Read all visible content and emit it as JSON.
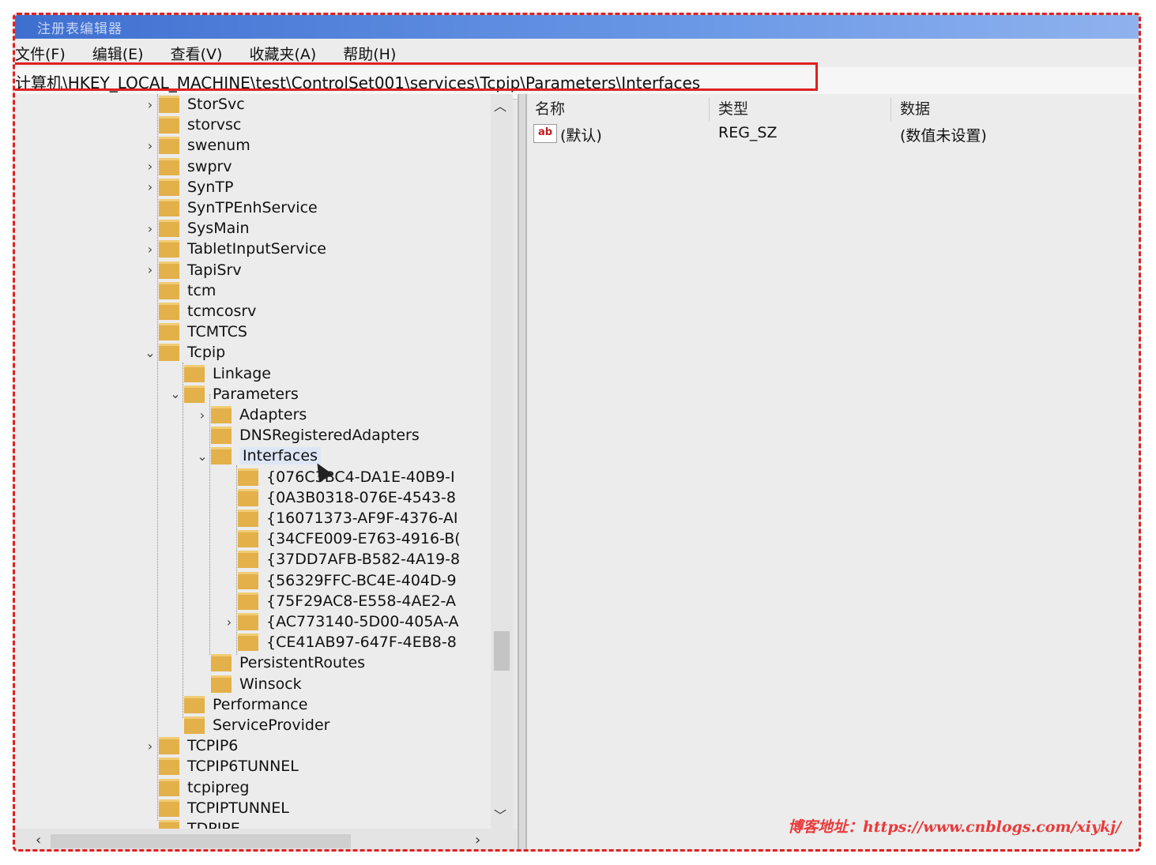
{
  "window": {
    "title": "注册表编辑器"
  },
  "menu": [
    "文件(F)",
    "编辑(E)",
    "查看(V)",
    "收藏夹(A)",
    "帮助(H)"
  ],
  "address": "计算机\\HKEY_LOCAL_MACHINE\\test\\ControlSet001\\services\\Tcpip\\Parameters\\Interfaces",
  "tree": {
    "level1": [
      {
        "label": "StorSvc",
        "chevron": ">"
      },
      {
        "label": "storvsc",
        "chevron": ""
      },
      {
        "label": "swenum",
        "chevron": ">"
      },
      {
        "label": "swprv",
        "chevron": ">"
      },
      {
        "label": "SynTP",
        "chevron": ">"
      },
      {
        "label": "SynTPEnhService",
        "chevron": ""
      },
      {
        "label": "SysMain",
        "chevron": ">"
      },
      {
        "label": "TabletInputService",
        "chevron": ">"
      },
      {
        "label": "TapiSrv",
        "chevron": ">"
      },
      {
        "label": "tcm",
        "chevron": ""
      },
      {
        "label": "tcmcosrv",
        "chevron": ""
      },
      {
        "label": "TCMTCS",
        "chevron": ""
      },
      {
        "label": "Tcpip",
        "chevron": "v"
      }
    ],
    "tcpip_children": [
      {
        "label": "Linkage",
        "chevron": ""
      },
      {
        "label": "Parameters",
        "chevron": "v"
      }
    ],
    "parameters_children": [
      {
        "label": "Adapters",
        "chevron": ">"
      },
      {
        "label": "DNSRegisteredAdapters",
        "chevron": ""
      },
      {
        "label": "Interfaces",
        "chevron": "v"
      }
    ],
    "interfaces_children": [
      {
        "label": "{076C3BC4-DA1E-40B9-I",
        "chevron": ""
      },
      {
        "label": "{0A3B0318-076E-4543-8",
        "chevron": ""
      },
      {
        "label": "{16071373-AF9F-4376-AI",
        "chevron": ""
      },
      {
        "label": "{34CFE009-E763-4916-B(",
        "chevron": ""
      },
      {
        "label": "{37DD7AFB-B582-4A19-8",
        "chevron": ""
      },
      {
        "label": "{56329FFC-BC4E-404D-9",
        "chevron": ""
      },
      {
        "label": "{75F29AC8-E558-4AE2-A",
        "chevron": ""
      },
      {
        "label": "{AC773140-5D00-405A-A",
        "chevron": ">"
      },
      {
        "label": "{CE41AB97-647F-4EB8-8",
        "chevron": ""
      }
    ],
    "parameters_more": [
      {
        "label": "PersistentRoutes",
        "chevron": ""
      },
      {
        "label": "Winsock",
        "chevron": ""
      }
    ],
    "tcpip_more": [
      {
        "label": "Performance",
        "chevron": ""
      },
      {
        "label": "ServiceProvider",
        "chevron": ""
      }
    ],
    "level1_more": [
      {
        "label": "TCPIP6",
        "chevron": ">"
      },
      {
        "label": "TCPIP6TUNNEL",
        "chevron": ""
      },
      {
        "label": "tcpipreg",
        "chevron": ""
      },
      {
        "label": "TCPIPTUNNEL",
        "chevron": ""
      },
      {
        "label": "TDPIPE",
        "chevron": ""
      }
    ]
  },
  "list": {
    "headers": {
      "name": "名称",
      "type": "类型",
      "data": "数据"
    },
    "rows": [
      {
        "icon": "ab",
        "name": "(默认)",
        "type": "REG_SZ",
        "data": "(数值未设置)"
      }
    ]
  },
  "watermark": "博客地址：https://www.cnblogs.com/xiykj/",
  "colors": {
    "highlight_border": "#e02020",
    "folder": "#e3b04a",
    "titlebar": "#3e6fd0"
  }
}
